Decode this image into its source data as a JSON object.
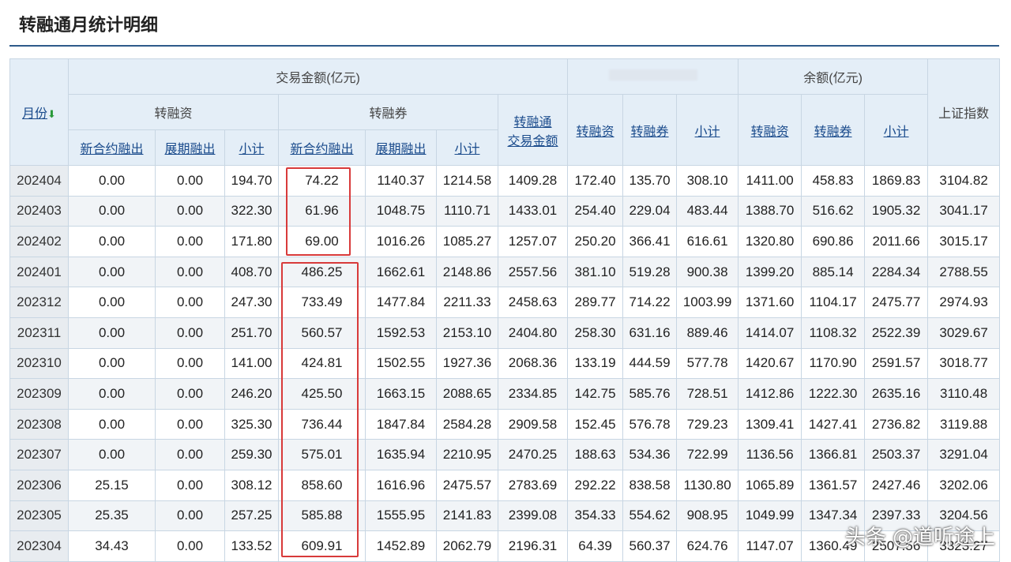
{
  "page": {
    "title": "转融通月统计明细",
    "watermark": "头条 @道听途上"
  },
  "table": {
    "headers": {
      "month": "月份",
      "trade_amount": "交易金额(亿元)",
      "balance": "余额(亿元)",
      "sh_index": "上证指数",
      "zrz": "转融资",
      "zrq": "转融券",
      "zrt_trade_amount_line1": "转融通",
      "zrt_trade_amount_line2": "交易金额",
      "new_contract": "新合约融出",
      "extended": "展期融出",
      "subtotal": "小计"
    },
    "rows": [
      {
        "month": "202404",
        "zrz_new": "0.00",
        "zrz_ext": "0.00",
        "zrz_sub": "194.70",
        "zrq_new": "74.22",
        "zrq_ext": "1140.37",
        "zrq_sub": "1214.58",
        "zrt_amt": "1409.28",
        "m_zrz": "172.40",
        "m_zrq": "135.70",
        "m_sub": "308.10",
        "b_zrz": "1411.00",
        "b_zrq": "458.83",
        "b_sub": "1869.83",
        "idx": "3104.82"
      },
      {
        "month": "202403",
        "zrz_new": "0.00",
        "zrz_ext": "0.00",
        "zrz_sub": "322.30",
        "zrq_new": "61.96",
        "zrq_ext": "1048.75",
        "zrq_sub": "1110.71",
        "zrt_amt": "1433.01",
        "m_zrz": "254.40",
        "m_zrq": "229.04",
        "m_sub": "483.44",
        "b_zrz": "1388.70",
        "b_zrq": "516.62",
        "b_sub": "1905.32",
        "idx": "3041.17"
      },
      {
        "month": "202402",
        "zrz_new": "0.00",
        "zrz_ext": "0.00",
        "zrz_sub": "171.80",
        "zrq_new": "69.00",
        "zrq_ext": "1016.26",
        "zrq_sub": "1085.27",
        "zrt_amt": "1257.07",
        "m_zrz": "250.20",
        "m_zrq": "366.41",
        "m_sub": "616.61",
        "b_zrz": "1320.80",
        "b_zrq": "690.86",
        "b_sub": "2011.66",
        "idx": "3015.17"
      },
      {
        "month": "202401",
        "zrz_new": "0.00",
        "zrz_ext": "0.00",
        "zrz_sub": "408.70",
        "zrq_new": "486.25",
        "zrq_ext": "1662.61",
        "zrq_sub": "2148.86",
        "zrt_amt": "2557.56",
        "m_zrz": "381.10",
        "m_zrq": "519.28",
        "m_sub": "900.38",
        "b_zrz": "1399.20",
        "b_zrq": "885.14",
        "b_sub": "2284.34",
        "idx": "2788.55"
      },
      {
        "month": "202312",
        "zrz_new": "0.00",
        "zrz_ext": "0.00",
        "zrz_sub": "247.30",
        "zrq_new": "733.49",
        "zrq_ext": "1477.84",
        "zrq_sub": "2211.33",
        "zrt_amt": "2458.63",
        "m_zrz": "289.77",
        "m_zrq": "714.22",
        "m_sub": "1003.99",
        "b_zrz": "1371.60",
        "b_zrq": "1104.17",
        "b_sub": "2475.77",
        "idx": "2974.93"
      },
      {
        "month": "202311",
        "zrz_new": "0.00",
        "zrz_ext": "0.00",
        "zrz_sub": "251.70",
        "zrq_new": "560.57",
        "zrq_ext": "1592.53",
        "zrq_sub": "2153.10",
        "zrt_amt": "2404.80",
        "m_zrz": "258.30",
        "m_zrq": "631.16",
        "m_sub": "889.46",
        "b_zrz": "1414.07",
        "b_zrq": "1108.32",
        "b_sub": "2522.39",
        "idx": "3029.67"
      },
      {
        "month": "202310",
        "zrz_new": "0.00",
        "zrz_ext": "0.00",
        "zrz_sub": "141.00",
        "zrq_new": "424.81",
        "zrq_ext": "1502.55",
        "zrq_sub": "1927.36",
        "zrt_amt": "2068.36",
        "m_zrz": "133.19",
        "m_zrq": "444.59",
        "m_sub": "577.78",
        "b_zrz": "1420.67",
        "b_zrq": "1170.90",
        "b_sub": "2591.57",
        "idx": "3018.77"
      },
      {
        "month": "202309",
        "zrz_new": "0.00",
        "zrz_ext": "0.00",
        "zrz_sub": "246.20",
        "zrq_new": "425.50",
        "zrq_ext": "1663.15",
        "zrq_sub": "2088.65",
        "zrt_amt": "2334.85",
        "m_zrz": "142.75",
        "m_zrq": "585.76",
        "m_sub": "728.51",
        "b_zrz": "1412.86",
        "b_zrq": "1222.30",
        "b_sub": "2635.16",
        "idx": "3110.48"
      },
      {
        "month": "202308",
        "zrz_new": "0.00",
        "zrz_ext": "0.00",
        "zrz_sub": "325.30",
        "zrq_new": "736.44",
        "zrq_ext": "1847.84",
        "zrq_sub": "2584.28",
        "zrt_amt": "2909.58",
        "m_zrz": "152.45",
        "m_zrq": "576.78",
        "m_sub": "729.23",
        "b_zrz": "1309.41",
        "b_zrq": "1427.41",
        "b_sub": "2736.82",
        "idx": "3119.88"
      },
      {
        "month": "202307",
        "zrz_new": "0.00",
        "zrz_ext": "0.00",
        "zrz_sub": "259.30",
        "zrq_new": "575.01",
        "zrq_ext": "1635.94",
        "zrq_sub": "2210.95",
        "zrt_amt": "2470.25",
        "m_zrz": "188.63",
        "m_zrq": "534.36",
        "m_sub": "722.99",
        "b_zrz": "1136.56",
        "b_zrq": "1366.81",
        "b_sub": "2503.37",
        "idx": "3291.04"
      },
      {
        "month": "202306",
        "zrz_new": "25.15",
        "zrz_ext": "0.00",
        "zrz_sub": "308.12",
        "zrq_new": "858.60",
        "zrq_ext": "1616.96",
        "zrq_sub": "2475.57",
        "zrt_amt": "2783.69",
        "m_zrz": "292.22",
        "m_zrq": "838.58",
        "m_sub": "1130.80",
        "b_zrz": "1065.89",
        "b_zrq": "1361.57",
        "b_sub": "2427.46",
        "idx": "3202.06"
      },
      {
        "month": "202305",
        "zrz_new": "25.35",
        "zrz_ext": "0.00",
        "zrz_sub": "257.25",
        "zrq_new": "585.88",
        "zrq_ext": "1555.95",
        "zrq_sub": "2141.83",
        "zrt_amt": "2399.08",
        "m_zrz": "354.33",
        "m_zrq": "554.62",
        "m_sub": "908.95",
        "b_zrz": "1049.99",
        "b_zrq": "1347.34",
        "b_sub": "2397.33",
        "idx": "3204.56"
      },
      {
        "month": "202304",
        "zrz_new": "34.43",
        "zrz_ext": "0.00",
        "zrz_sub": "133.52",
        "zrq_new": "609.91",
        "zrq_ext": "1452.89",
        "zrq_sub": "2062.79",
        "zrt_amt": "2196.31",
        "m_zrz": "64.39",
        "m_zrq": "560.37",
        "m_sub": "624.76",
        "b_zrz": "1147.07",
        "b_zrq": "1360.49",
        "b_sub": "2507.56",
        "idx": "3323.27"
      }
    ]
  }
}
